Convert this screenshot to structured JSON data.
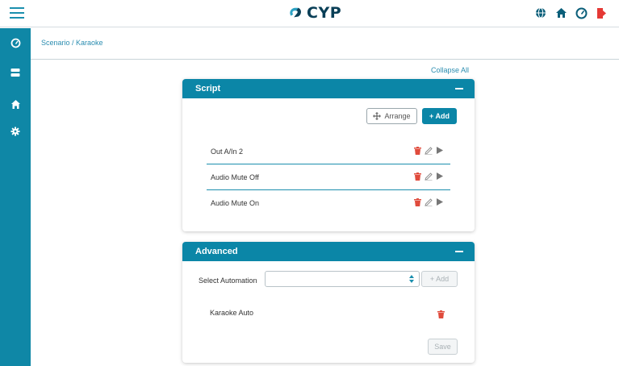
{
  "header": {
    "brand": "CYP",
    "icons": [
      "menu-icon",
      "globe-icon",
      "home-icon",
      "gauge-icon",
      "logout-icon"
    ]
  },
  "sidebar": {
    "items": [
      {
        "name": "dashboard",
        "icon": "gauge-icon"
      },
      {
        "name": "devices",
        "icon": "server-icon"
      },
      {
        "name": "scenario",
        "icon": "home-icon"
      },
      {
        "name": "settings",
        "icon": "gear-icon"
      }
    ]
  },
  "breadcrumb": "Scenario / Karaoke",
  "collapse_all": "Collapse All",
  "script_panel": {
    "title": "Script",
    "arrange_label": "Arrange",
    "add_label": "+ Add",
    "rows": [
      {
        "label": "Out A/In 2"
      },
      {
        "label": "Audio Mute Off"
      },
      {
        "label": "Audio Mute On"
      }
    ]
  },
  "advanced_panel": {
    "title": "Advanced",
    "select_label": "Select Automation",
    "select_value": "",
    "add_label": "+ Add",
    "automations": [
      {
        "label": "Karaoke Auto"
      }
    ],
    "save_label": "Save"
  },
  "colors": {
    "accent": "#0b86a7",
    "delete": "#e04b3c",
    "logout": "#e53935"
  }
}
